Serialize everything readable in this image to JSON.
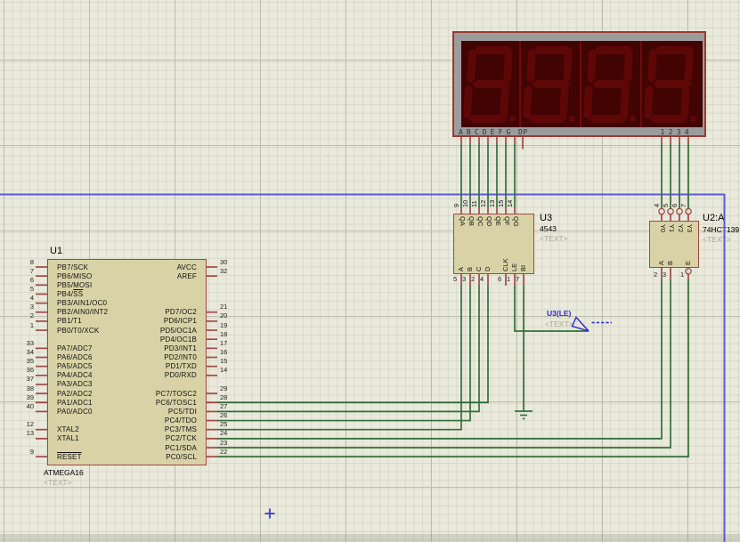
{
  "colors": {
    "background": "#e9e9dc",
    "grid_minor": "#d8d8ca",
    "grid_major": "#bcbcae",
    "chip_fill": "#d8d2a6",
    "chip_border": "#9e4b44",
    "wire_green": "#336f38",
    "pin_red": "#9e4b44",
    "region_blue": "#5a5ad4",
    "probe_blue": "#2828cc",
    "placeholder_gray": "#a9a99b",
    "display_bezel": "#9c9c9c",
    "display_background": "#420303",
    "segment_off": "#5e0707"
  },
  "display": {
    "type": "7-segment-4-digit",
    "digits": 4,
    "digit_states": [
      "",
      "",
      "",
      ""
    ],
    "bezel_label_segments": "ABCDEFG",
    "bezel_label_dp": "DP",
    "bezel_label_digits": "1234"
  },
  "u1": {
    "ref": "U1",
    "value": "ATMEGA16",
    "text_placeholder": "<TEXT>",
    "left_pins": [
      {
        "num": "8",
        "name": "PB7/SCK",
        "over": "",
        "row": 0
      },
      {
        "num": "7",
        "name": "PB6/MISO",
        "over": "",
        "row": 1
      },
      {
        "num": "6",
        "name": "PB5/MOSI",
        "over": "",
        "row": 2
      },
      {
        "num": "5",
        "name": "PB4/",
        "over": "SS",
        "row": 3
      },
      {
        "num": "4",
        "name": "PB3/AIN1/OC0",
        "over": "",
        "row": 4
      },
      {
        "num": "3",
        "name": "PB2/AIN0/INT2",
        "over": "",
        "row": 5
      },
      {
        "num": "2",
        "name": "PB1/T1",
        "over": "",
        "row": 6
      },
      {
        "num": "1",
        "name": "PB0/T0/XCK",
        "over": "",
        "row": 7
      },
      {
        "num": "33",
        "name": "PA7/ADC7",
        "over": "",
        "row": 9
      },
      {
        "num": "34",
        "name": "PA6/ADC6",
        "over": "",
        "row": 10
      },
      {
        "num": "35",
        "name": "PA5/ADC5",
        "over": "",
        "row": 11
      },
      {
        "num": "36",
        "name": "PA4/ADC4",
        "over": "",
        "row": 12
      },
      {
        "num": "37",
        "name": "PA3/ADC3",
        "over": "",
        "row": 13
      },
      {
        "num": "38",
        "name": "PA2/ADC2",
        "over": "",
        "row": 14
      },
      {
        "num": "39",
        "name": "PA1/ADC1",
        "over": "",
        "row": 15
      },
      {
        "num": "40",
        "name": "PA0/ADC0",
        "over": "",
        "row": 16
      },
      {
        "num": "12",
        "name": "XTAL2",
        "over": "",
        "row": 18
      },
      {
        "num": "13",
        "name": "XTAL1",
        "over": "",
        "row": 19
      },
      {
        "num": "9",
        "name": "",
        "over": "RESET",
        "row": 21
      }
    ],
    "right_pins": [
      {
        "num": "30",
        "name": "AVCC",
        "row": 0
      },
      {
        "num": "32",
        "name": "AREF",
        "row": 1
      },
      {
        "num": "21",
        "name": "PD7/OC2",
        "row": 5
      },
      {
        "num": "20",
        "name": "PD6/ICP1",
        "row": 6
      },
      {
        "num": "19",
        "name": "PD5/OC1A",
        "row": 7
      },
      {
        "num": "18",
        "name": "PD4/OC1B",
        "row": 8
      },
      {
        "num": "17",
        "name": "PD3/INT1",
        "row": 9
      },
      {
        "num": "16",
        "name": "PD2/INT0",
        "row": 10
      },
      {
        "num": "15",
        "name": "PD1/TXD",
        "row": 11
      },
      {
        "num": "14",
        "name": "PD0/RXD",
        "row": 12
      },
      {
        "num": "29",
        "name": "PC7/TOSC2",
        "row": 14
      },
      {
        "num": "28",
        "name": "PC6/TOSC1",
        "row": 15
      },
      {
        "num": "27",
        "name": "PC5/TDI",
        "row": 16
      },
      {
        "num": "26",
        "name": "PC4/TDO",
        "row": 17
      },
      {
        "num": "25",
        "name": "PC3/TMS",
        "row": 18
      },
      {
        "num": "24",
        "name": "PC2/TCK",
        "row": 19
      },
      {
        "num": "23",
        "name": "PC1/SDA",
        "row": 20
      },
      {
        "num": "22",
        "name": "PC0/SCL",
        "row": 21
      }
    ]
  },
  "u3": {
    "ref": "U3",
    "value": "4543",
    "text_placeholder": "<TEXT>",
    "top_pins": [
      {
        "num": "9",
        "name": "QA",
        "col": 0
      },
      {
        "num": "10",
        "name": "QB",
        "col": 1
      },
      {
        "num": "11",
        "name": "QC",
        "col": 2
      },
      {
        "num": "12",
        "name": "QD",
        "col": 3
      },
      {
        "num": "13",
        "name": "QE",
        "col": 4
      },
      {
        "num": "15",
        "name": "QF",
        "col": 5
      },
      {
        "num": "14",
        "name": "QG",
        "col": 6
      }
    ],
    "bottom_pins": [
      {
        "num": "5",
        "name": "A",
        "col": 0
      },
      {
        "num": "3",
        "name": "B",
        "col": 1
      },
      {
        "num": "2",
        "name": "C",
        "col": 2
      },
      {
        "num": "4",
        "name": "D",
        "col": 3
      },
      {
        "num": "6",
        "name": "CLK",
        "col": 5
      },
      {
        "num": "1",
        "name": "LE",
        "col": 6
      },
      {
        "num": "7",
        "name": "BI",
        "col": 7
      }
    ]
  },
  "u2": {
    "ref": "U2:A",
    "value": "74HCT139",
    "text_placeholder": "<TEXT>",
    "top_pins": [
      {
        "num": "4",
        "name": "Y0",
        "col": 0,
        "bubble": true
      },
      {
        "num": "5",
        "name": "Y1",
        "col": 1,
        "bubble": true
      },
      {
        "num": "6",
        "name": "Y2",
        "col": 2,
        "bubble": true
      },
      {
        "num": "7",
        "name": "Y3",
        "col": 3,
        "bubble": true
      }
    ],
    "bottom_pins": [
      {
        "num": "2",
        "name": "A",
        "col": 0,
        "bubble": false
      },
      {
        "num": "3",
        "name": "B",
        "col": 1,
        "bubble": false
      },
      {
        "num": "1",
        "name": "E",
        "col": 3,
        "bubble": true
      }
    ]
  },
  "probe": {
    "label": "U3(LE)",
    "text_placeholder": "<TEXT>"
  },
  "markers": {
    "region_border": true,
    "origin_marker": true,
    "ground_symbol": true
  },
  "nets": [
    {
      "from": "7SEG.A",
      "to": "U3.QA",
      "route": "v"
    },
    {
      "from": "7SEG.B",
      "to": "U3.QB",
      "route": "v"
    },
    {
      "from": "7SEG.C",
      "to": "U3.QC",
      "route": "v"
    },
    {
      "from": "7SEG.D",
      "to": "U3.QD",
      "route": "v"
    },
    {
      "from": "7SEG.E",
      "to": "U3.QE",
      "route": "v"
    },
    {
      "from": "7SEG.F",
      "to": "U3.QF",
      "route": "v"
    },
    {
      "from": "7SEG.G",
      "to": "U3.QG",
      "route": "v"
    },
    {
      "from": "7SEG.1",
      "to": "U2.Y0",
      "route": "v"
    },
    {
      "from": "7SEG.2",
      "to": "U2.Y1",
      "route": "v"
    },
    {
      "from": "7SEG.3",
      "to": "U2.Y2",
      "route": "v"
    },
    {
      "from": "7SEG.4",
      "to": "U2.Y3",
      "route": "v"
    },
    {
      "from": "U1.PC6/TOSC1",
      "to": "U3.D",
      "route": "hv"
    },
    {
      "from": "U1.PC5/TDI",
      "to": "U3.C",
      "route": "hv"
    },
    {
      "from": "U1.PC4/TDO",
      "to": "U3.B",
      "route": "hv"
    },
    {
      "from": "U1.PC3/TMS",
      "to": "U3.A",
      "route": "hv"
    },
    {
      "from": "U1.PC2/TCK",
      "to": "U2.A",
      "route": "hv"
    },
    {
      "from": "U1.PC1/SDA",
      "to": "U2.B",
      "route": "hv"
    },
    {
      "from": "U1.PC0/SCL",
      "to": "U2.E",
      "route": "hv"
    },
    {
      "from": "U3.LE",
      "to": "PROBE.tip",
      "route": "vh"
    },
    {
      "from": "U3.BI",
      "to": "GND.top",
      "route": "v"
    }
  ]
}
